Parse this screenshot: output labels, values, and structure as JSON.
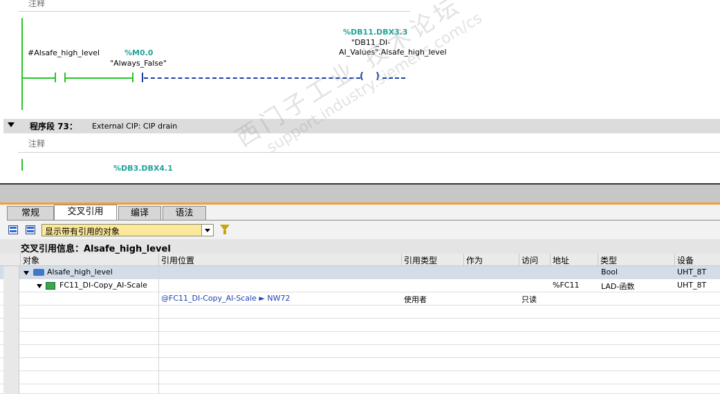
{
  "editor": {
    "network_top": {
      "comment": "注释",
      "contact1_label": "#Alsafe_high_level",
      "contact2_addr": "%M0.0",
      "contact2_label": "\"Always_False\"",
      "coil_addr": "%DB11.DBX3.3",
      "coil_label": "\"DB11_DI-AI_Values\".Alsafe_high_level"
    },
    "segment": {
      "title": "程序段 73：",
      "description": "External CIP: CIP drain",
      "comment": "注释",
      "partial_addr": "%DB3.DBX4.1"
    }
  },
  "inspector": {
    "tabs": [
      "常规",
      "交叉引用",
      "编译",
      "语法"
    ],
    "active_tab": "交叉引用",
    "filter_value": "显示带有引用的对象",
    "info_title": "交叉引用信息：Alsafe_high_level",
    "columns": [
      "对象",
      "引用位置",
      "引用类型",
      "作为",
      "访问",
      "地址",
      "类型",
      "设备"
    ],
    "rows": [
      {
        "object": "Alsafe_high_level",
        "location": "",
        "ref_type": "",
        "as": "",
        "access": "",
        "address": "",
        "type": "Bool",
        "device": "UHT_8T"
      },
      {
        "object": "FC11_DI-Copy_AI-Scale",
        "location": "",
        "ref_type": "",
        "as": "",
        "access": "",
        "address": "%FC11",
        "type": "LAD-函数",
        "device": "UHT_8T"
      },
      {
        "object": "",
        "location": "@FC11_DI-Copy_AI-Scale ► NW72",
        "ref_type": "使用者",
        "as": "",
        "access": "只读",
        "address": "",
        "type": "",
        "device": ""
      }
    ]
  },
  "watermark": {
    "line1": "西门子工业 技术论坛",
    "line2": "support.industry.siemens.com/cs"
  },
  "colors": {
    "rung_green": "#25c525",
    "rung_blue": "#1a3ca8",
    "address_teal": "#1fa39a",
    "filter_yellow": "#fce89a",
    "splitter_orange": "#f0a030"
  }
}
